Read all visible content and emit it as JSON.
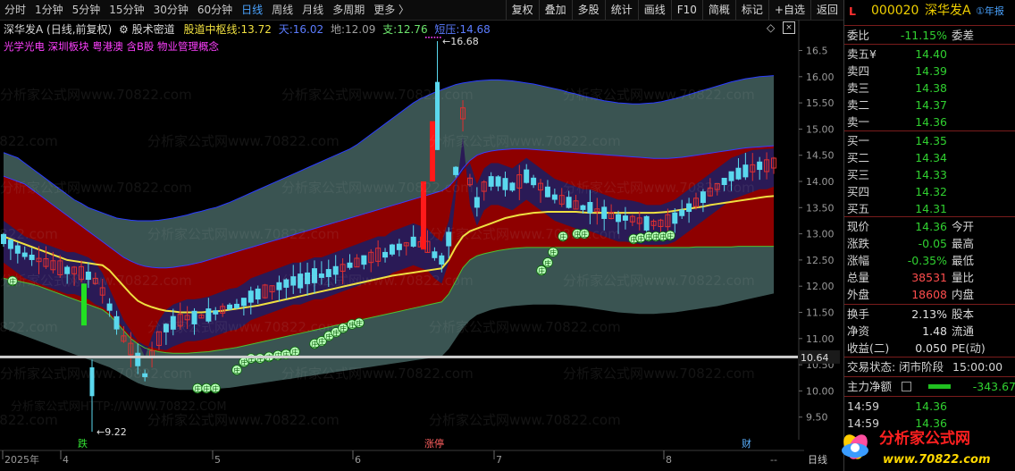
{
  "toolbar": {
    "periods": [
      "分时",
      "1分钟",
      "5分钟",
      "15分钟",
      "30分钟",
      "60分钟",
      "日线",
      "周线",
      "月线",
      "多周期",
      "更多 〉"
    ],
    "active_period": "日线",
    "tools": [
      "复权",
      "叠加",
      "多股",
      "统计",
      "画线",
      "F10",
      "简概",
      "标记",
      "+自选",
      "返回"
    ]
  },
  "chart": {
    "title": "深华发A (日线,前复权)",
    "indicator_name": "股术密道",
    "line_label": "股道中枢线:",
    "line_value": "13.72",
    "sky_label": "天:",
    "sky_value": "16.02",
    "earth_label": "地:",
    "earth_value": "12.09",
    "support_label": "支:",
    "support_value": "12.76",
    "pressure_label": "短压:",
    "pressure_value": "14.68",
    "concepts": "光学光电  深圳板块  粤港澳  含B股  物业管理概念",
    "watermark": "分析家公式网www.70822.com",
    "watermark2": "分析家公式网HTTP://WWW.70822.COM",
    "max_mark": "16.68",
    "min_mark": "9.22",
    "current_price_tag": "10.64",
    "flag_die": "跌",
    "flag_zhangting": "涨停",
    "flag_cai": "财",
    "zhuang": "庄",
    "x_labels": [
      "2025年",
      "4",
      "5",
      "6",
      "7",
      "8"
    ],
    "right_end": "日线",
    "right_end2": "--",
    "y_ticks": [
      "16.5",
      "16.00",
      "15.50",
      "15.00",
      "14.50",
      "14.00",
      "13.50",
      "13.00",
      "12.50",
      "12.00",
      "11.50",
      "11.00",
      "10.50",
      "10.00",
      "9.50"
    ],
    "colors": {
      "red_band": "#8e0000",
      "gray_band": "#3a5452",
      "purple": "#2a1a56",
      "mid_line": "#f0e040",
      "up_candle": "#5ad8ee",
      "down_candle": "#e03030"
    }
  },
  "chart_data": {
    "type": "candlestick",
    "y_range": [
      9.22,
      16.68
    ],
    "y_ticks": [
      16.5,
      16.0,
      15.5,
      15.0,
      14.5,
      14.0,
      13.5,
      13.0,
      12.5,
      12.0,
      11.5,
      11.0,
      10.5,
      10.0,
      9.5
    ],
    "x_labels": [
      "2025年",
      "4",
      "5",
      "6",
      "7",
      "8"
    ],
    "annotations": {
      "max": 16.68,
      "min": 9.22,
      "price_tag": 10.64
    },
    "centers": [
      12.9,
      12.8,
      12.7,
      12.6,
      12.55,
      12.5,
      12.45,
      12.4,
      12.35,
      12.3,
      12.3,
      12.25,
      12.2,
      12.1,
      11.9,
      11.6,
      11.3,
      11.0,
      10.8,
      10.6,
      10.3,
      10.7,
      11.0,
      11.2,
      11.3,
      11.35,
      11.4,
      11.4,
      11.42,
      11.45,
      11.5,
      11.55,
      11.6,
      11.62,
      11.7,
      11.8,
      11.85,
      11.9,
      11.95,
      12.0,
      12.05,
      12.1,
      12.1,
      12.15,
      12.2,
      12.2,
      12.25,
      12.3,
      12.35,
      12.4,
      12.45,
      12.5,
      12.55,
      12.6,
      12.6,
      12.7,
      12.75,
      12.8,
      12.85,
      12.8,
      12.75,
      12.6,
      12.5,
      12.9,
      14.2,
      15.3,
      14.0,
      13.6,
      13.9,
      14.0,
      14.0,
      13.95,
      13.9,
      14.0,
      14.1,
      14.0,
      13.9,
      13.8,
      13.7,
      13.65,
      13.6,
      13.55,
      13.5,
      13.5,
      13.45,
      13.4,
      13.35,
      13.3,
      13.3,
      13.28,
      13.25,
      13.2,
      13.2,
      13.2,
      13.25,
      13.3,
      13.4,
      13.5,
      13.6,
      13.7,
      13.8,
      13.9,
      14.0,
      14.1,
      14.15,
      14.2,
      14.25,
      14.3,
      14.3,
      14.35
    ],
    "upper_outer": [
      14.55,
      14.5,
      14.45,
      14.35,
      14.25,
      14.15,
      14.05,
      13.95,
      13.85,
      13.75,
      13.65,
      13.58,
      13.5,
      13.45,
      13.4,
      13.35,
      13.3,
      13.28,
      13.26,
      13.25,
      13.25,
      13.25,
      13.26,
      13.28,
      13.3,
      13.33,
      13.36,
      13.4,
      13.43,
      13.47,
      13.5,
      13.55,
      13.6,
      13.66,
      13.72,
      13.78,
      13.84,
      13.9,
      13.96,
      14.02,
      14.08,
      14.14,
      14.2,
      14.26,
      14.32,
      14.38,
      14.44,
      14.5,
      14.56,
      14.62,
      14.7,
      14.8,
      14.9,
      15.0,
      15.1,
      15.2,
      15.3,
      15.4,
      15.5,
      15.58,
      15.64,
      15.7,
      15.75,
      15.8,
      15.85,
      15.88,
      15.9,
      15.92,
      15.93,
      15.94,
      15.94,
      15.93,
      15.92,
      15.9,
      15.88,
      15.86,
      15.83,
      15.8,
      15.77,
      15.74,
      15.7,
      15.67,
      15.63,
      15.6,
      15.57,
      15.54,
      15.52,
      15.5,
      15.49,
      15.48,
      15.48,
      15.49,
      15.5,
      15.52,
      15.55,
      15.58,
      15.62,
      15.66,
      15.7,
      15.74,
      15.78,
      15.82,
      15.86,
      15.9,
      15.93,
      15.96,
      15.98,
      16.0,
      16.01,
      16.02
    ],
    "upper_inner": [
      14.1,
      14.05,
      14.0,
      13.95,
      13.85,
      13.75,
      13.65,
      13.55,
      13.45,
      13.35,
      13.25,
      13.15,
      13.05,
      12.95,
      12.85,
      12.75,
      12.65,
      12.55,
      12.48,
      12.42,
      12.38,
      12.36,
      12.35,
      12.35,
      12.36,
      12.38,
      12.4,
      12.43,
      12.46,
      12.5,
      12.54,
      12.58,
      12.62,
      12.66,
      12.7,
      12.74,
      12.78,
      12.82,
      12.86,
      12.9,
      12.94,
      12.98,
      13.02,
      13.06,
      13.1,
      13.14,
      13.18,
      13.22,
      13.26,
      13.3,
      13.34,
      13.38,
      13.42,
      13.46,
      13.5,
      13.54,
      13.58,
      13.62,
      13.66,
      13.7,
      13.74,
      13.78,
      13.82,
      13.9,
      14.05,
      14.25,
      14.4,
      14.5,
      14.55,
      14.58,
      14.6,
      14.61,
      14.62,
      14.62,
      14.62,
      14.61,
      14.6,
      14.59,
      14.58,
      14.57,
      14.56,
      14.55,
      14.54,
      14.53,
      14.52,
      14.51,
      14.5,
      14.49,
      14.48,
      14.47,
      14.46,
      14.45,
      14.44,
      14.44,
      14.44,
      14.45,
      14.46,
      14.48,
      14.5,
      14.52,
      14.54,
      14.56,
      14.58,
      14.6,
      14.62,
      14.64,
      14.65,
      14.66,
      14.67,
      14.68
    ],
    "mid_line": [
      12.95,
      12.9,
      12.85,
      12.8,
      12.75,
      12.7,
      12.65,
      12.6,
      12.55,
      12.5,
      12.48,
      12.46,
      12.44,
      12.42,
      12.4,
      12.3,
      12.15,
      12.0,
      11.85,
      11.72,
      11.65,
      11.6,
      11.56,
      11.53,
      11.52,
      11.5,
      11.5,
      11.5,
      11.5,
      11.51,
      11.52,
      11.53,
      11.55,
      11.57,
      11.59,
      11.61,
      11.63,
      11.66,
      11.69,
      11.72,
      11.75,
      11.78,
      11.81,
      11.84,
      11.87,
      11.9,
      11.93,
      11.96,
      11.99,
      12.02,
      12.05,
      12.08,
      12.11,
      12.14,
      12.17,
      12.2,
      12.22,
      12.24,
      12.26,
      12.28,
      12.3,
      12.32,
      12.34,
      12.5,
      12.75,
      12.95,
      13.05,
      13.1,
      13.15,
      13.2,
      13.25,
      13.3,
      13.33,
      13.36,
      13.38,
      13.4,
      13.41,
      13.42,
      13.42,
      13.42,
      13.42,
      13.42,
      13.41,
      13.4,
      13.4,
      13.4,
      13.4,
      13.4,
      13.4,
      13.4,
      13.4,
      13.4,
      13.4,
      13.41,
      13.42,
      13.44,
      13.46,
      13.48,
      13.5,
      13.52,
      13.55,
      13.57,
      13.59,
      13.61,
      13.63,
      13.65,
      13.67,
      13.69,
      13.71,
      13.72
    ],
    "lower_inner": [
      12.15,
      12.12,
      12.1,
      12.07,
      12.04,
      12.0,
      11.95,
      11.9,
      11.85,
      11.8,
      11.75,
      11.7,
      11.65,
      11.6,
      11.55,
      11.45,
      11.3,
      11.15,
      11.0,
      10.9,
      10.82,
      10.78,
      10.75,
      10.73,
      10.72,
      10.72,
      10.72,
      10.73,
      10.74,
      10.75,
      10.77,
      10.79,
      10.81,
      10.83,
      10.86,
      10.89,
      10.92,
      10.95,
      10.98,
      11.01,
      11.04,
      11.07,
      11.1,
      11.13,
      11.16,
      11.19,
      11.22,
      11.25,
      11.28,
      11.31,
      11.34,
      11.37,
      11.4,
      11.43,
      11.46,
      11.49,
      11.52,
      11.55,
      11.58,
      11.61,
      11.64,
      11.67,
      11.7,
      11.85,
      12.1,
      12.35,
      12.5,
      12.58,
      12.62,
      12.65,
      12.68,
      12.7,
      12.72,
      12.73,
      12.74,
      12.74,
      12.74,
      12.74,
      12.74,
      12.74,
      12.74,
      12.74,
      12.74,
      12.74,
      12.74,
      12.74,
      12.74,
      12.74,
      12.74,
      12.74,
      12.74,
      12.74,
      12.74,
      12.74,
      12.74,
      12.74,
      12.74,
      12.74,
      12.75,
      12.75,
      12.75,
      12.75,
      12.75,
      12.75,
      12.76,
      12.76,
      12.76,
      12.76,
      12.76,
      12.76
    ],
    "lower_outer": [
      11.2,
      11.15,
      11.1,
      11.05,
      11.0,
      10.95,
      10.9,
      10.85,
      10.8,
      10.75,
      10.7,
      10.65,
      10.6,
      10.55,
      10.5,
      10.45,
      10.38,
      10.3,
      10.22,
      10.15,
      10.1,
      10.07,
      10.05,
      10.04,
      10.03,
      10.02,
      10.02,
      10.02,
      10.02,
      10.03,
      10.04,
      10.05,
      10.06,
      10.08,
      10.1,
      10.12,
      10.14,
      10.16,
      10.18,
      10.2,
      10.22,
      10.24,
      10.26,
      10.28,
      10.3,
      10.32,
      10.34,
      10.36,
      10.38,
      10.4,
      10.42,
      10.44,
      10.46,
      10.48,
      10.5,
      10.52,
      10.54,
      10.56,
      10.58,
      10.6,
      10.62,
      10.64,
      10.66,
      10.8,
      11.0,
      11.2,
      11.35,
      11.45,
      11.5,
      11.55,
      11.58,
      11.6,
      11.62,
      11.63,
      11.64,
      11.65,
      11.65,
      11.65,
      11.65,
      11.64,
      11.63,
      11.62,
      11.6,
      11.58,
      11.56,
      11.54,
      11.52,
      11.5,
      11.49,
      11.48,
      11.47,
      11.47,
      11.47,
      11.48,
      11.49,
      11.5,
      11.52,
      11.54,
      11.56,
      11.58,
      11.6,
      11.62,
      11.65,
      11.68,
      11.71,
      11.74,
      11.77,
      11.8,
      11.83,
      11.86
    ]
  },
  "quote": {
    "code_prefix": "L",
    "code": "000020",
    "name": "深华发A",
    "report_link": "①年报",
    "weibi_label": "委比",
    "weibi_value": "-11.15%",
    "weicha_label": "委差",
    "asks": [
      {
        "label": "卖五¥",
        "price": "14.40"
      },
      {
        "label": "卖四",
        "price": "14.39"
      },
      {
        "label": "卖三",
        "price": "14.38"
      },
      {
        "label": "卖二",
        "price": "14.37"
      },
      {
        "label": "卖一",
        "price": "14.36"
      }
    ],
    "bids": [
      {
        "label": "买一",
        "price": "14.35"
      },
      {
        "label": "买二",
        "price": "14.34"
      },
      {
        "label": "买三",
        "price": "14.33"
      },
      {
        "label": "买四",
        "price": "14.32"
      },
      {
        "label": "买五",
        "price": "14.31"
      }
    ],
    "stats1": [
      {
        "l": "现价",
        "v": "14.36",
        "vc": "dn",
        "r": "今开"
      },
      {
        "l": "涨跌",
        "v": "-0.05",
        "vc": "dn",
        "r": "最高"
      },
      {
        "l": "涨幅",
        "v": "-0.35%",
        "vc": "dn",
        "r": "最低"
      },
      {
        "l": "总量",
        "v": "38531",
        "vc": "up",
        "r": "量比"
      },
      {
        "l": "外盘",
        "v": "18608",
        "vc": "up",
        "r": "内盘"
      }
    ],
    "stats2": [
      {
        "l": "换手",
        "v": "2.13%",
        "vc": "wh",
        "r": "股本"
      },
      {
        "l": "净资",
        "v": "1.48",
        "vc": "wh",
        "r": "流通"
      },
      {
        "l": "收益(二)",
        "v": "0.050",
        "vc": "wh",
        "r": "PE(动)"
      }
    ],
    "status_label": "交易状态: 闭市阶段",
    "status_time": "15:00:00",
    "netflow_label": "主力净额",
    "netflow_value": "-343.67",
    "ticks": [
      {
        "t": "14:59",
        "p": "14.36"
      },
      {
        "t": "14:59",
        "p": "14.36"
      }
    ]
  },
  "logo": {
    "text": "分析家公式网",
    "url": "www.70822.com"
  }
}
